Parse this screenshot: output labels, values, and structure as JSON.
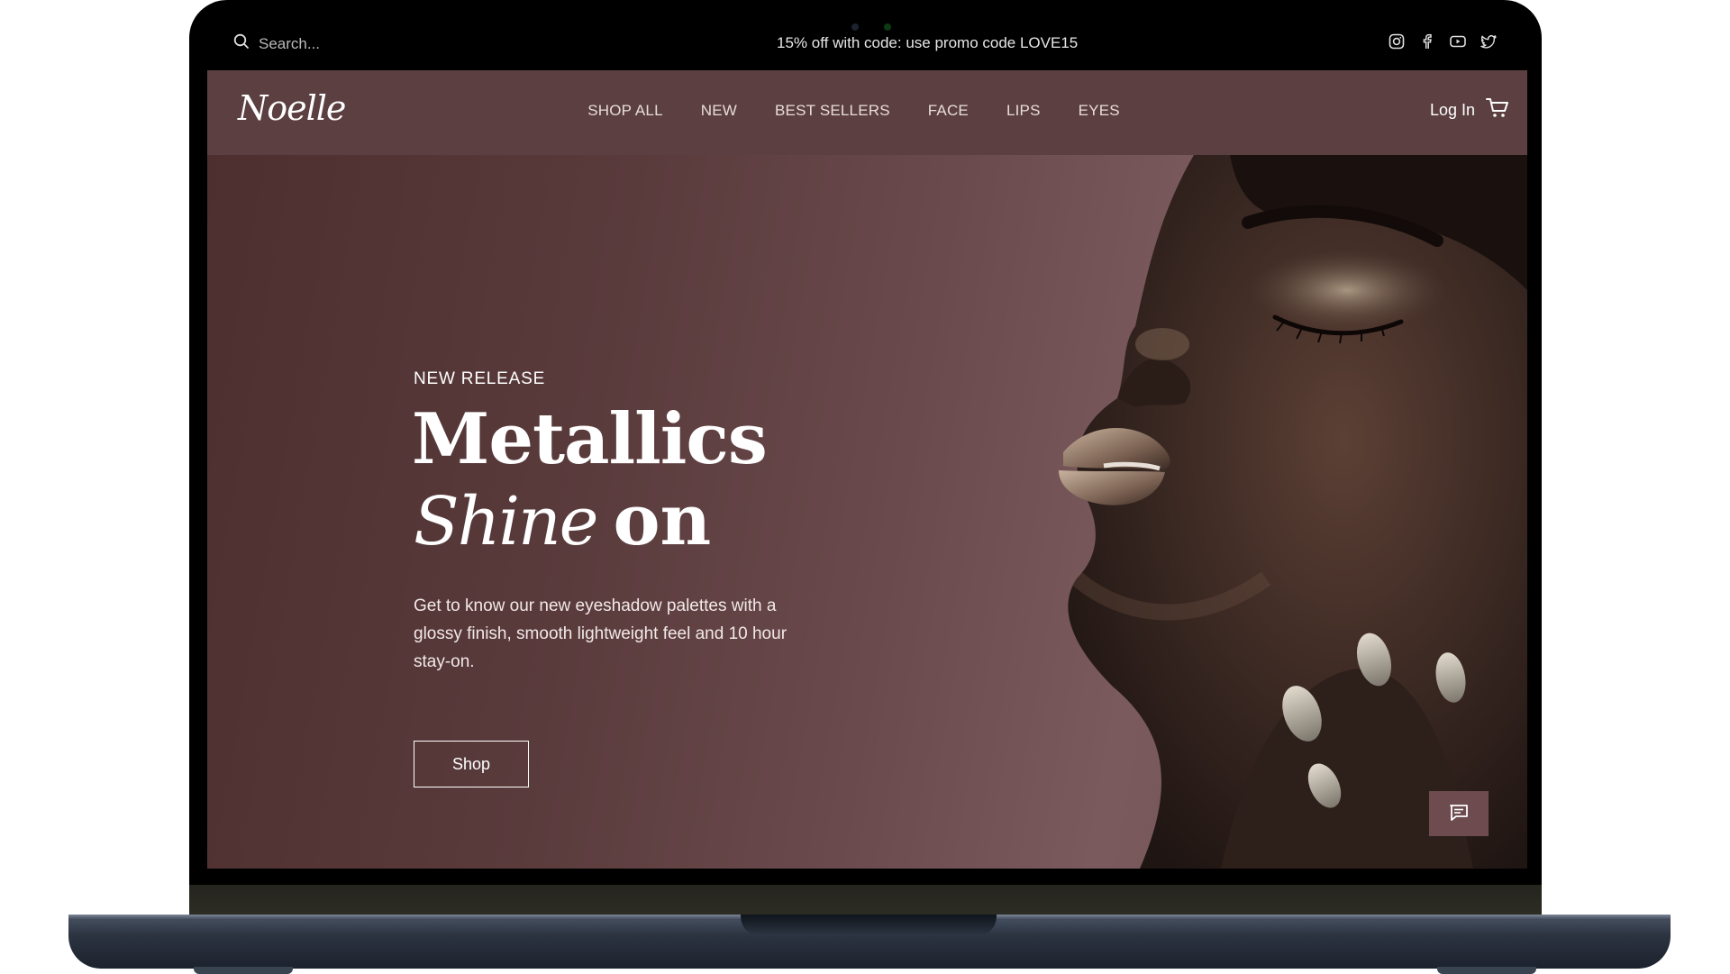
{
  "topbar": {
    "search_placeholder": "Search...",
    "promo_text": "15% off with code: use promo code LOVE15",
    "social_icons": [
      "instagram-icon",
      "facebook-icon",
      "youtube-icon",
      "twitter-icon"
    ]
  },
  "nav": {
    "logo": "Noelle",
    "items": [
      {
        "label": "SHOP ALL"
      },
      {
        "label": "NEW"
      },
      {
        "label": "BEST SELLERS"
      },
      {
        "label": "FACE"
      },
      {
        "label": "LIPS"
      },
      {
        "label": "EYES"
      }
    ],
    "login_label": "Log In",
    "cart_icon": "cart-icon"
  },
  "hero": {
    "eyebrow": "NEW RELEASE",
    "headline_line1": "Metallics",
    "headline_script": "Shine",
    "headline_bold": "on",
    "description": "Get to know our new eyeshadow palettes with a glossy finish, smooth lightweight feel and 10 hour stay-on.",
    "cta_label": "Shop",
    "chat_icon": "chat-icon"
  },
  "colors": {
    "nav_bg": "#5c3f40",
    "hero_bg": "#5a3b3c",
    "accent_text": "#ffffff"
  }
}
